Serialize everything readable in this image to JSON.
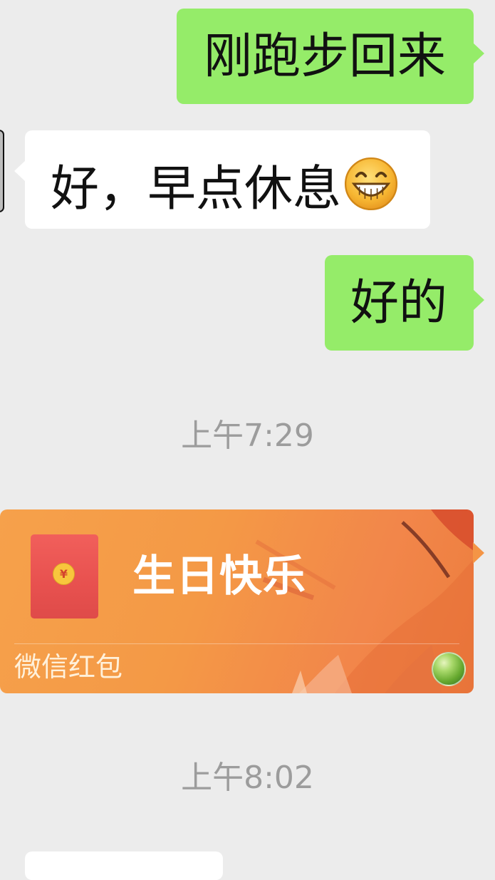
{
  "messages": [
    {
      "side": "right",
      "text": "刚跑步回来"
    },
    {
      "side": "left",
      "text": "好，早点休息",
      "emoji": "grinning-face-emoji"
    },
    {
      "side": "right",
      "text": "好的"
    }
  ],
  "timestamps": {
    "first": "上午7:29",
    "second": "上午8:02"
  },
  "red_packet": {
    "title": "生日快乐",
    "label": "微信红包",
    "currency_symbol": "¥",
    "colors": {
      "background": "#F49946",
      "envelope": "#E8514F",
      "coin": "#F8C63D"
    }
  },
  "colors": {
    "chat_background": "#ECECEC",
    "sent_bubble": "#95EC69",
    "received_bubble": "#FFFFFF",
    "timestamp_text": "#9C9C9C"
  }
}
